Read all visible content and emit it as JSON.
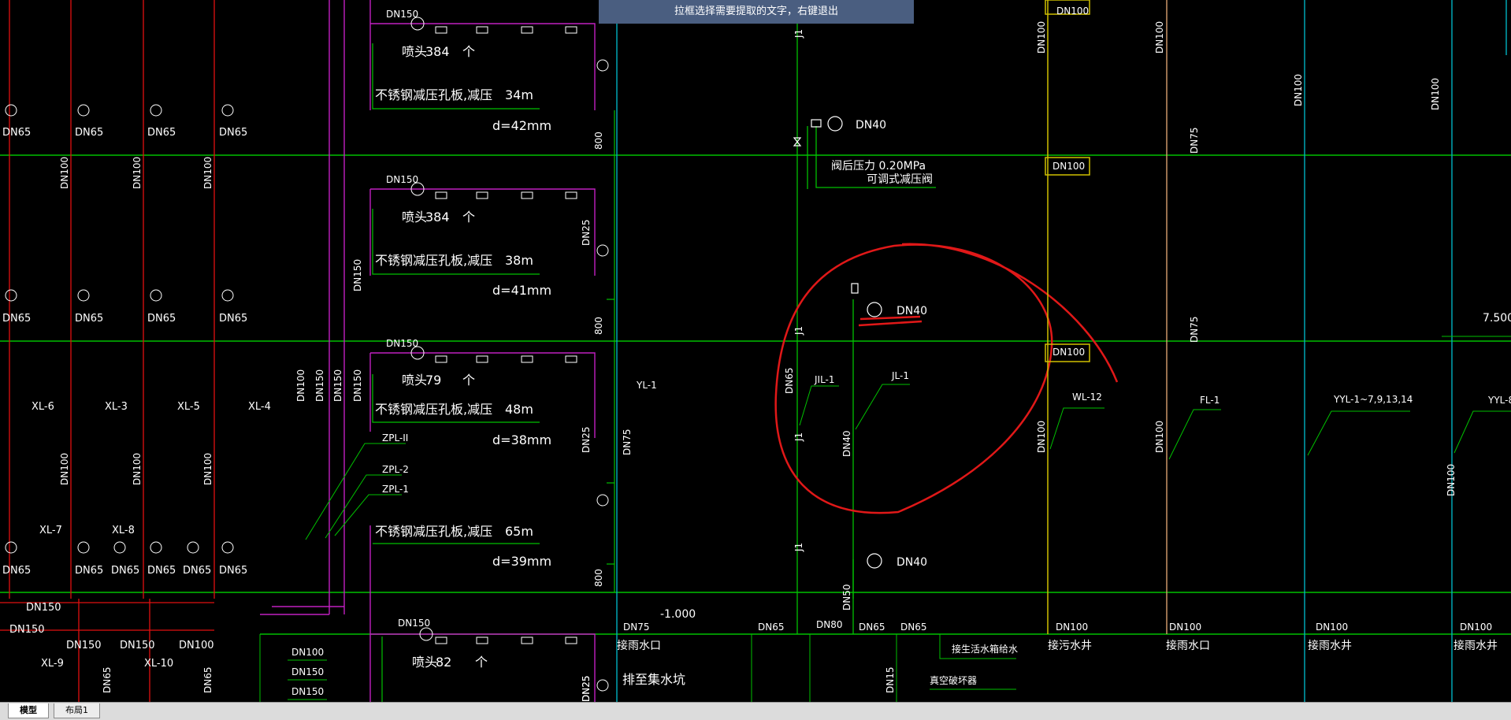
{
  "hint_bar": {
    "text": "拉框选择需要提取的文字，右键退出"
  },
  "tabs": [
    {
      "label": "模型"
    },
    {
      "label": "布局1"
    }
  ],
  "drawing": {
    "left_columns": {
      "pipe_dn": [
        "DN100",
        "DN100",
        "DN100"
      ],
      "hydrant_dn": "DN65",
      "risers": [
        "XL-6",
        "XL-3",
        "XL-5",
        "XL-4"
      ],
      "risers_lower": [
        "XL-7",
        "XL-8",
        "XL-9",
        "XL-10"
      ],
      "mains": [
        "DN150",
        "DN150",
        "DN150",
        "DN150",
        "DN100"
      ]
    },
    "sprinkler_blocks": [
      {
        "pipe": "DN150",
        "heads_label": "喷头",
        "heads": "384",
        "unit": "个",
        "orifice": "不锈钢减压孔板,减压",
        "pressure": "34m",
        "diameter": "d=42mm",
        "riser_dn": "800"
      },
      {
        "pipe": "DN150",
        "heads_label": "喷头",
        "heads": "384",
        "unit": "个",
        "orifice": "不锈钢减压孔板,减压",
        "pressure": "38m",
        "diameter": "d=41mm",
        "riser_dn": "800"
      },
      {
        "pipe": "DN150",
        "heads_label": "喷头",
        "heads": "79",
        "unit": "个",
        "orifice": "不锈钢减压孔板,减压",
        "pressure": "48m",
        "diameter": "d=38mm",
        "riser_dn": "800"
      },
      {
        "pipe": "",
        "heads_label": "",
        "heads": "",
        "unit": "",
        "orifice": "不锈钢减压孔板,减压",
        "pressure": "65m",
        "diameter": "d=39mm",
        "riser_dn": "800"
      }
    ],
    "bottom_block": {
      "pipe": "DN150",
      "heads_label": "喷头",
      "heads": "82",
      "unit": "个",
      "note": "排至集水坑"
    },
    "vertical_dn": [
      "DN150",
      "DN150",
      "DN100",
      "DN150",
      "DN150",
      "DN25",
      "DN25",
      "DN75",
      "DN25"
    ],
    "zpl": [
      "ZPL-II",
      "ZPL-2",
      "ZPL-1"
    ],
    "center": {
      "valve_dn_top": "DN40",
      "pressure_note": "阀后压力  0.20MPa",
      "pressure_valve": "可调式减压阀",
      "valve_dn_mid": "DN40",
      "valve_dn_low": "DN40",
      "j1_letters": "J1",
      "jl_labels": [
        "JIL-1",
        "JL-1"
      ],
      "pipe_dn": [
        "DN65",
        "DN40",
        "DN50"
      ],
      "yl1": "YL-1",
      "elev": "-1.000"
    },
    "right_columns": {
      "labels": [
        "WL-12",
        "FL-1",
        "YYL-1~7,9,13,14",
        "YYL-8"
      ],
      "dn": [
        "DN100",
        "DN100",
        "DN75",
        "DN75",
        "DN100",
        "DN100",
        "DN100",
        "DN100"
      ],
      "elevation": "7.500"
    },
    "bottom_row": {
      "labels": [
        "接雨水口",
        "接污水井",
        "接雨水口",
        "接雨水井",
        "接雨水井"
      ],
      "dn": [
        "DN75",
        "DN65",
        "DN80",
        "DN65",
        "DN65",
        "DN100",
        "DN100",
        "DN100",
        "DN100"
      ],
      "notes": [
        "接生活水箱给水",
        "真空破坏器"
      ],
      "misc_dn": [
        "DN100",
        "DN150",
        "DN150",
        "DN15",
        "DN65",
        "DN65",
        "DN25"
      ]
    }
  }
}
